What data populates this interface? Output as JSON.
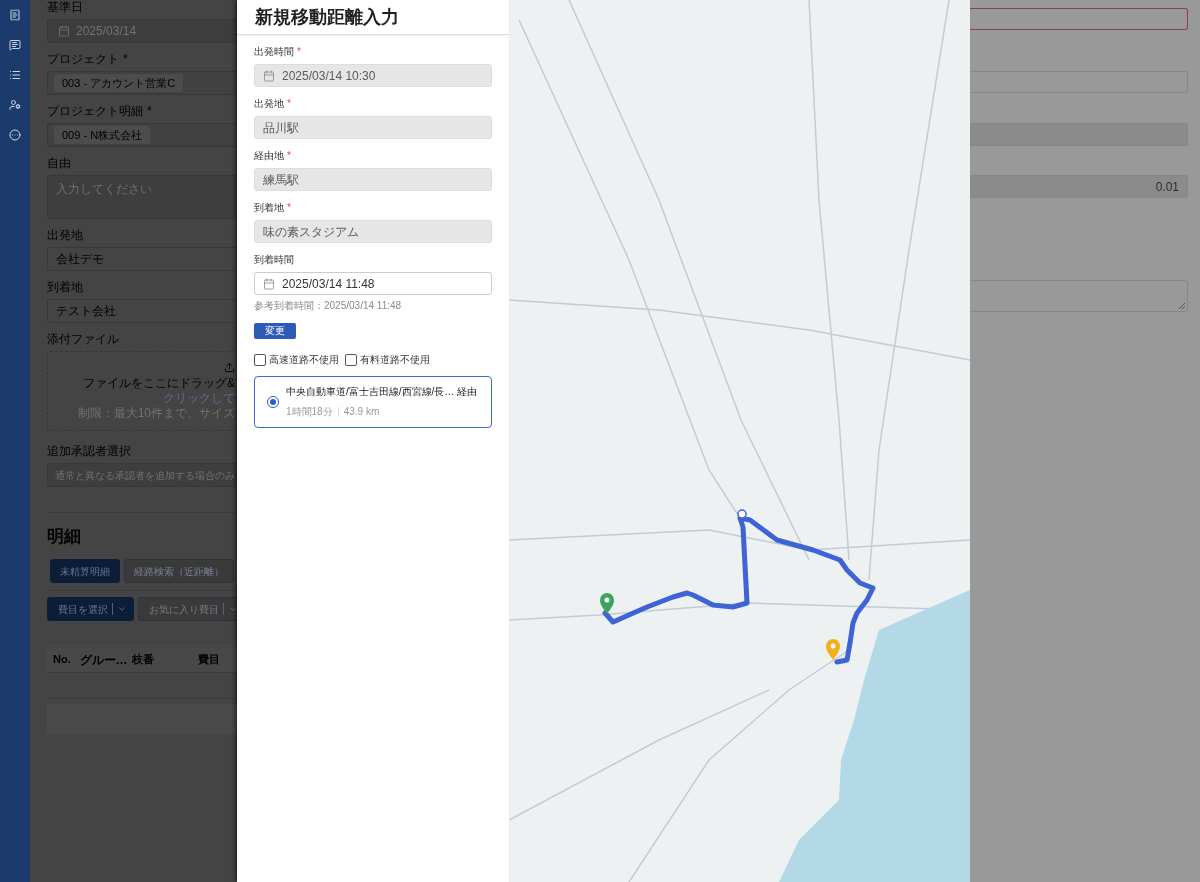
{
  "background_form": {
    "fields": [
      {
        "kind": "date",
        "label": "基準日",
        "value": "2025/03/14"
      },
      {
        "kind": "tag",
        "label": "プロジェクト",
        "required_mark": "*",
        "tag": "003 - アカウント営業C"
      },
      {
        "kind": "tag",
        "label": "プロジェクト明細",
        "required_mark": "*",
        "tag": "009 - N株式会社"
      },
      {
        "kind": "textarea",
        "label": "自由",
        "placeholder": "入力してください"
      },
      {
        "kind": "text",
        "label": "出発地",
        "value": "会社デモ"
      },
      {
        "kind": "text",
        "label": "到着地",
        "value": "テスト会社"
      },
      {
        "kind": "upload",
        "label": "添付ファイル",
        "instruction": "ファイルをここにドラッグ&",
        "link": "クリックして",
        "limit": "制限：最大10件まで、サイズ"
      },
      {
        "kind": "select",
        "label": "追加承認者選択",
        "placeholder": "通常と異なる承認者を追加する場合のみ"
      }
    ],
    "section_title": "明細",
    "tabs": [
      {
        "label": "未精算明細",
        "selected": true
      },
      {
        "label": "経路検索（近距離）",
        "selected": false
      }
    ],
    "expense_buttons": [
      {
        "kind": "primary",
        "label": "費目を選択"
      },
      {
        "kind": "default",
        "label": "お気に入り費目"
      }
    ],
    "table": {
      "columns": [
        "No.",
        "グルー…",
        "枝番",
        "費目"
      ]
    }
  },
  "drawer": {
    "title": "新規移動距離入力",
    "fields": [
      {
        "kind": "datetime",
        "label": "出発時間",
        "required_mark": "*",
        "value": "2025/03/14 10:30",
        "disabled": true
      },
      {
        "kind": "text",
        "label": "出発地",
        "required_mark": "*",
        "value": "品川駅",
        "disabled": true
      },
      {
        "kind": "text",
        "label": "経由地",
        "required_mark": "*",
        "value": "練馬駅",
        "disabled": true
      },
      {
        "kind": "text",
        "label": "到着地",
        "required_mark": "*",
        "value": "味の素スタジアム",
        "disabled": true
      },
      {
        "kind": "datetime",
        "label": "到着時間",
        "value": "2025/03/14 11:48",
        "disabled": false,
        "hint": "参考到着時間：2025/03/14 11:48"
      }
    ],
    "change_button": "変更",
    "options": [
      {
        "label": "高速道路不使用",
        "checked": false
      },
      {
        "label": "有料道路不使用",
        "checked": false
      }
    ],
    "routes": [
      {
        "title": "中央自動車道/富士吉田線/西宮線/長…",
        "via": "経由",
        "duration": "1時間18分",
        "distance": "43.9 km",
        "selected": true
      }
    ]
  },
  "right_panel": {
    "fields": [
      {
        "kind": "input",
        "invalid": true
      },
      {
        "kind": "input",
        "invalid": false
      },
      {
        "kind": "readonly",
        "invalid": false
      },
      {
        "kind": "readonly",
        "invalid": false,
        "value": "0.01"
      },
      {
        "kind": "textarea",
        "invalid": false
      }
    ]
  }
}
